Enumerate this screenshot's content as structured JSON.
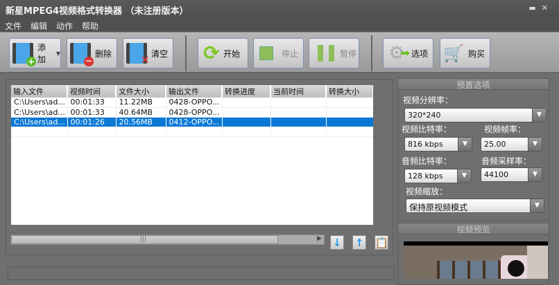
{
  "window": {
    "title": "新星MPEG4视频格式转换器 （未注册版本）"
  },
  "menu": [
    "文件",
    "编辑",
    "动作",
    "帮助"
  ],
  "toolbar": {
    "add": "添加",
    "delete": "删除",
    "clear": "清空",
    "start": "开始",
    "stop": "停止",
    "pause": "暂停",
    "options": "选项",
    "buy": "购买"
  },
  "table": {
    "columns": [
      "输入文件",
      "视频时间",
      "文件大小",
      "输出文件",
      "转换进度",
      "当前时间",
      "转换大小"
    ],
    "rows": [
      [
        "C:\\Users\\ad...",
        "00:01:33",
        "11.22MB",
        "0428-OPPO...",
        "",
        "",
        ""
      ],
      [
        "C:\\Users\\ad...",
        "00:01:33",
        "40.64MB",
        "0428-OPPO...",
        "",
        "",
        ""
      ],
      [
        "C:\\Users\\ad...",
        "00:01:26",
        "20.56MB",
        "0412-OPPO...",
        "",
        "",
        ""
      ]
    ],
    "selected_row": 2
  },
  "presets": {
    "title": "预置选项",
    "resolution_label": "视频分辨率：",
    "resolution": "320*240",
    "vbitrate_label": "视频比特率：",
    "vbitrate": "816 kbps",
    "fps_label": "视频帧率：",
    "fps": "25.00",
    "abitrate_label": "音频比特率：",
    "abitrate": "128 kbps",
    "samplerate_label": "音频采样率：",
    "samplerate": "44100",
    "scale_label": "视频缩放：",
    "scale": "保持原视频模式"
  },
  "preview": {
    "title": "视频预览"
  }
}
